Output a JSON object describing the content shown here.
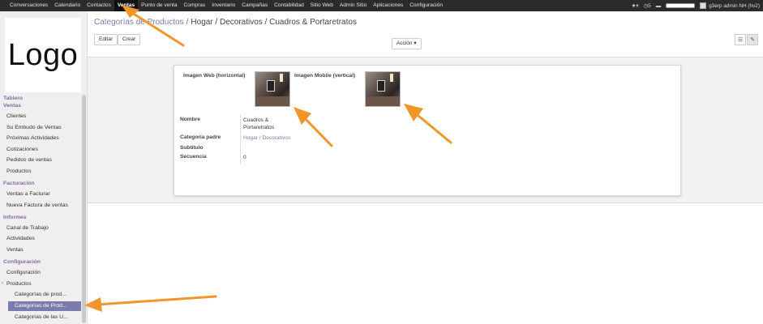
{
  "navbar": {
    "items": [
      "Conversaciones",
      "Calendario",
      "Contactos",
      "Ventas",
      "Punto de venta",
      "Compras",
      "Inventario",
      "Campañas",
      "Contabilidad",
      "Sitio Web",
      "Admin Sitio",
      "Aplicaciones",
      "Configuración"
    ],
    "active_index": 3,
    "badge_count": "5",
    "user": "g3erp admin NH (hv2)"
  },
  "sidebar": {
    "logo_text": "Logo",
    "sections": [
      {
        "title": "Tablero"
      },
      {
        "title": "Ventas",
        "items": [
          "Clientes",
          "Su Embudo de Ventas",
          "Próximas Actividades",
          "Cotizaciones",
          "Pedidos de ventas",
          "Productos"
        ]
      },
      {
        "title": "Facturación",
        "items": [
          "Ventas a Facturar",
          "Nueva Factura de ventas"
        ]
      },
      {
        "title": "Informes",
        "items": [
          "Canal de Trabajo",
          "Actividades",
          "Ventas"
        ]
      },
      {
        "title": "Configuración",
        "items": [
          "Configuración",
          "Productos"
        ]
      }
    ],
    "sub_items": [
      "Categorías de prod...",
      "Categorías de Prod...",
      "Categorías de las U..."
    ]
  },
  "breadcrumb": {
    "root": "Categorías de Productos",
    "sep": "/",
    "current": "Hogar / Decorativos / Cuadros & Portaretratos"
  },
  "buttons": {
    "edit": "Editar",
    "create": "Crear",
    "action": "Acción ▾"
  },
  "form": {
    "image_web_label": "Imagen Web (horizontal)",
    "image_mobile_label": "Imagen Mobile (vertical)",
    "name_label": "Nombre",
    "name_value_line1": "Cuadros &",
    "name_value_line2": "Portaretratos",
    "parent_label": "Categoría padre",
    "parent_value": "Hogar / Decorativos",
    "subtitle_label": "Subtítulo",
    "sequence_label": "Secuencia",
    "sequence_value": "0"
  },
  "colors": {
    "navbar_bg": "#2b2b2b",
    "accent": "#7c7bad",
    "annotation_arrow": "#f0962b"
  }
}
